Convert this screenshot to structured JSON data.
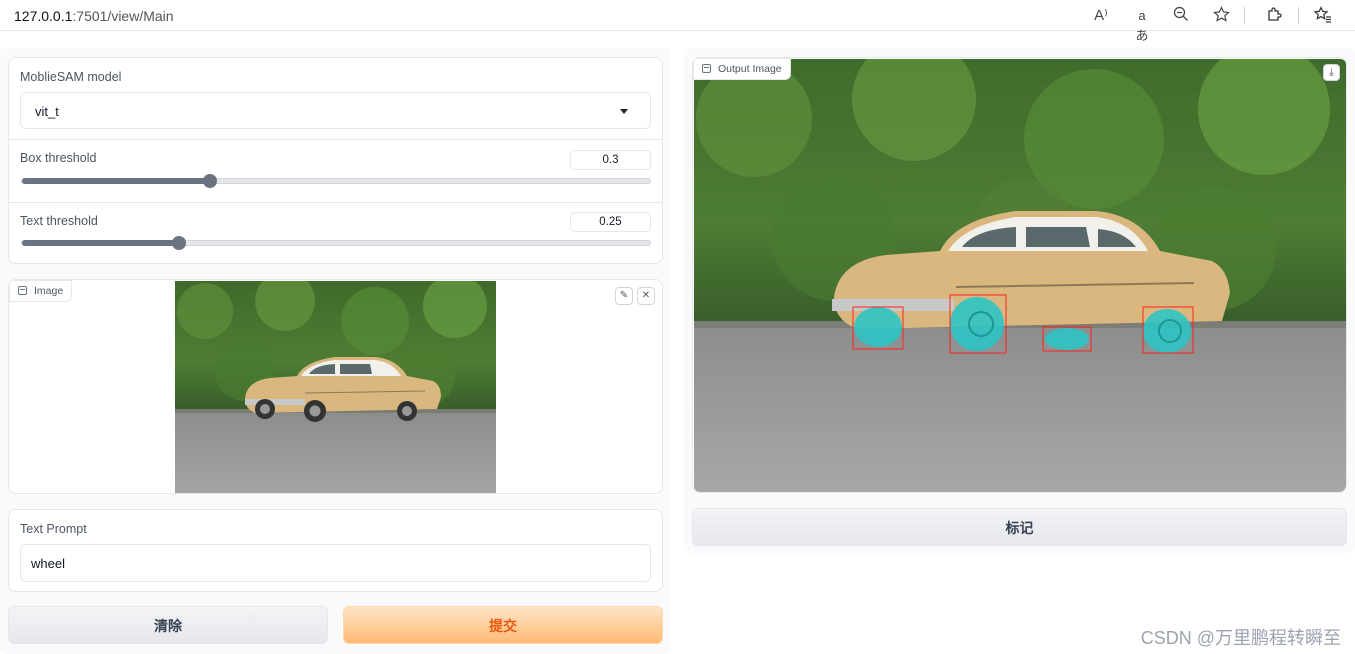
{
  "browser": {
    "url_host": "127.0.0.1",
    "url_rest": ":7501/view/Main",
    "icons": [
      "read-aloud-icon",
      "translate-icon",
      "zoom-icon",
      "favorite-star-icon",
      "extensions-icon",
      "favorites-list-icon"
    ],
    "read_aloud_glyph": "A⁾",
    "translate_glyph": "aあ"
  },
  "model": {
    "label": "MoblieSAM model",
    "value": "vit_t"
  },
  "box_threshold": {
    "label": "Box threshold",
    "value": "0.3",
    "fraction": 0.3
  },
  "text_threshold": {
    "label": "Text threshold",
    "value": "0.25",
    "fraction": 0.25
  },
  "input_image": {
    "label": "Image",
    "edit_icon": "pencil-icon",
    "close_icon": "close-icon"
  },
  "text_prompt": {
    "label": "Text Prompt",
    "value": "wheel"
  },
  "buttons": {
    "clear": "清除",
    "submit": "提交",
    "annotate": "标记"
  },
  "output_image": {
    "label": "Output Image",
    "download_icon": "download-icon"
  },
  "colors": {
    "accent": "#ea580c",
    "mask": "#2ec4c4",
    "box": "#ff2020"
  },
  "watermark": "CSDN @万里鹏程转瞬至"
}
